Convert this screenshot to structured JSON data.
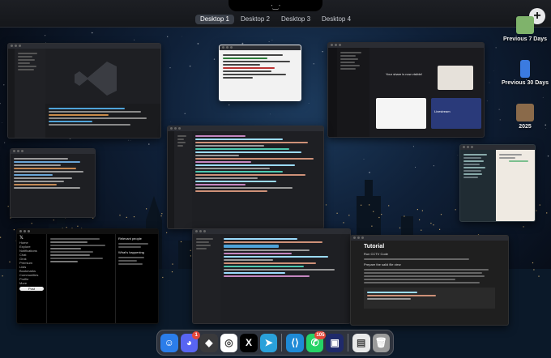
{
  "mission_control": {
    "desktops": [
      "Desktop 1",
      "Desktop 2",
      "Desktop 3",
      "Desktop 4"
    ],
    "active_desktop": 0,
    "add_desktop_symbol": "+",
    "notch_glyph": "ᐧ‿ᐧ"
  },
  "sidebar": {
    "items": [
      {
        "label": "Previous 7 Days",
        "icon": "folder-thumbnail-icon"
      },
      {
        "label": "Previous 30 Days",
        "icon": "phone-thumbnail-icon"
      },
      {
        "label": "2025",
        "icon": "folder-thumbnail-icon"
      }
    ]
  },
  "windows": {
    "tutorial": {
      "heading": "Tutorial",
      "subheading": "Run CCTV Code",
      "section": "Prepare the salid file view"
    },
    "twitter": {
      "menu": [
        "Home",
        "Explore",
        "Notifications",
        "Chat",
        "Grok",
        "Premium",
        "Lists",
        "Bookmarks",
        "Communities",
        "Profile",
        "More"
      ],
      "post_button": "Post",
      "right_header": "Relevant people",
      "whats_happening": "What's happening"
    },
    "meeting": {
      "title": "Your share is now visible!",
      "tile": "Livestream"
    }
  },
  "dock": {
    "apps": [
      {
        "name": "finder-icon",
        "glyph": "☺",
        "color": "#2b7de9"
      },
      {
        "name": "discord-icon",
        "glyph": "◕",
        "color": "#5865f2",
        "badge": "1"
      },
      {
        "name": "cube-icon",
        "glyph": "◆",
        "color": "#3a3a3c"
      },
      {
        "name": "chrome-icon",
        "glyph": "◎",
        "color": "#ffffff"
      },
      {
        "name": "x-icon",
        "glyph": "X",
        "color": "#000000"
      },
      {
        "name": "telegram-icon",
        "glyph": "➤",
        "color": "#2aa1da"
      },
      {
        "name": "vscode-icon",
        "glyph": "⟨⟩",
        "color": "#1e8ad6"
      },
      {
        "name": "whatsapp-icon",
        "glyph": "✆",
        "color": "#25d366",
        "badge": "105"
      },
      {
        "name": "terminal-app-icon",
        "glyph": "▣",
        "color": "#1f2a6b"
      },
      {
        "name": "document-icon",
        "glyph": "▤",
        "color": "#e9e9e9"
      },
      {
        "name": "trash-icon",
        "glyph": "🗑",
        "color": "#9a9a9a"
      }
    ]
  }
}
